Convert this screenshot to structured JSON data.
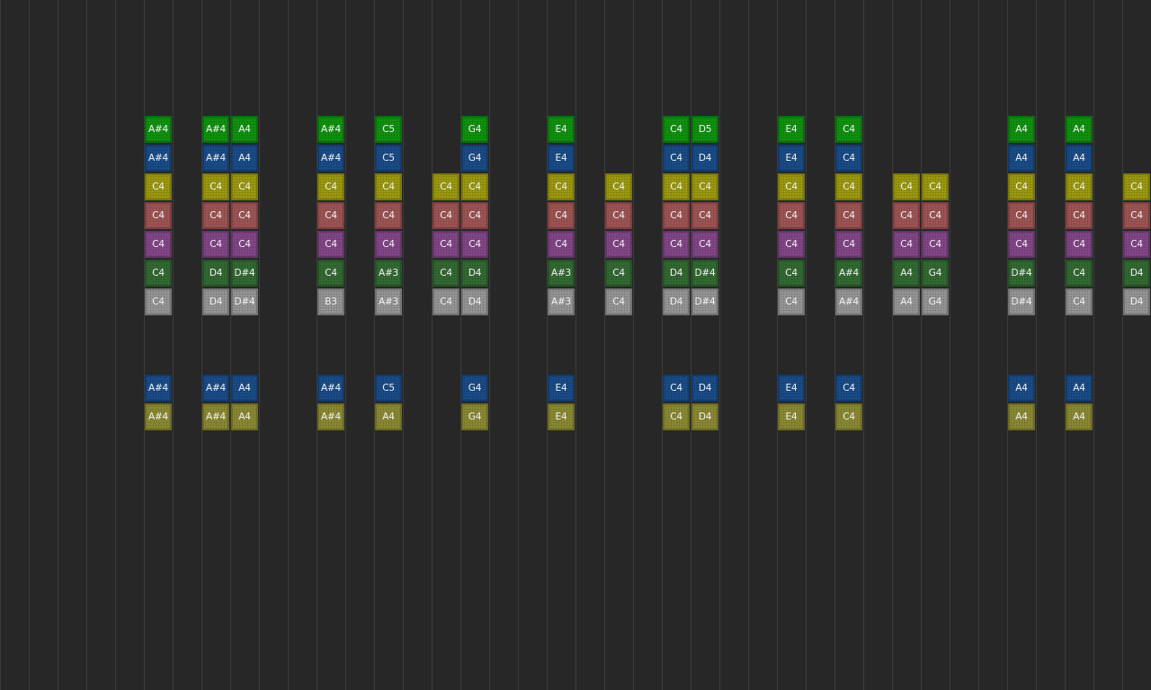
{
  "rows": [
    {
      "name": "green",
      "color": "#119811",
      "border": "#0b6e0b"
    },
    {
      "name": "blue",
      "color": "#1b4f8e",
      "border": "#123a69"
    },
    {
      "name": "yellow",
      "color": "#a3a010",
      "border": "#7b780a"
    },
    {
      "name": "red",
      "color": "#a55858",
      "border": "#7f3f3f"
    },
    {
      "name": "purple",
      "color": "#884a8d",
      "border": "#653569"
    },
    {
      "name": "darkgreen",
      "color": "#356e35",
      "border": "#245224"
    },
    {
      "name": "gray",
      "color": "#9c9c9c",
      "border": "#737373"
    },
    {
      "name": "blue2",
      "color": "#1b4f8e",
      "border": "#123a69"
    },
    {
      "name": "olive",
      "color": "#8f8f36",
      "border": "#6b6b22"
    }
  ],
  "columns": [
    {
      "col": 5,
      "notes": [
        "A#4",
        "A#4",
        "C4",
        "C4",
        "C4",
        "C4",
        "C4",
        "A#4",
        "A#4"
      ]
    },
    {
      "col": 7,
      "notes": [
        "A#4",
        "A#4",
        "C4",
        "C4",
        "C4",
        "D4",
        "D4",
        "A#4",
        "A#4"
      ]
    },
    {
      "col": 8,
      "notes": [
        "A4",
        "A4",
        "C4",
        "C4",
        "C4",
        "D#4",
        "D#4",
        "A4",
        "A4"
      ]
    },
    {
      "col": 11,
      "notes": [
        "A#4",
        "A#4",
        "C4",
        "C4",
        "C4",
        "C4",
        "B3",
        "A#4",
        "A#4"
      ]
    },
    {
      "col": 13,
      "notes": [
        "C5",
        "C5",
        "C4",
        "C4",
        "C4",
        "A#3",
        "A#3",
        "C5",
        "A4"
      ]
    },
    {
      "col": 15,
      "notes": [
        null,
        null,
        "C4",
        "C4",
        "C4",
        "C4",
        "C4",
        null,
        null
      ]
    },
    {
      "col": 16,
      "notes": [
        "G4",
        "G4",
        "C4",
        "C4",
        "C4",
        "D4",
        "D4",
        "G4",
        "G4"
      ]
    },
    {
      "col": 19,
      "notes": [
        "E4",
        "E4",
        "C4",
        "C4",
        "C4",
        "A#3",
        "A#3",
        "E4",
        "E4"
      ]
    },
    {
      "col": 21,
      "notes": [
        null,
        null,
        "C4",
        "C4",
        "C4",
        "C4",
        "C4",
        null,
        null
      ]
    },
    {
      "col": 23,
      "notes": [
        "C4",
        "C4",
        "C4",
        "C4",
        "C4",
        "D4",
        "D4",
        "C4",
        "C4"
      ]
    },
    {
      "col": 24,
      "notes": [
        "D5",
        "D4",
        "C4",
        "C4",
        "C4",
        "D#4",
        "D#4",
        "D4",
        "D4"
      ]
    },
    {
      "col": 27,
      "notes": [
        "E4",
        "E4",
        "C4",
        "C4",
        "C4",
        "C4",
        "C4",
        "E4",
        "E4"
      ]
    },
    {
      "col": 29,
      "notes": [
        "C4",
        "C4",
        "C4",
        "C4",
        "C4",
        "A#4",
        "A#4",
        "C4",
        "C4"
      ]
    },
    {
      "col": 31,
      "notes": [
        null,
        null,
        "C4",
        "C4",
        "C4",
        "A4",
        "A4",
        null,
        null
      ]
    },
    {
      "col": 32,
      "notes": [
        null,
        null,
        "C4",
        "C4",
        "C4",
        "G4",
        "G4",
        null,
        null
      ]
    },
    {
      "col": 35,
      "notes": [
        "A4",
        "A4",
        "C4",
        "C4",
        "C4",
        "D#4",
        "D#4",
        "A4",
        "A4"
      ]
    },
    {
      "col": 37,
      "notes": [
        "A4",
        "A4",
        "C4",
        "C4",
        "C4",
        "C4",
        "C4",
        "A4",
        "A4"
      ]
    },
    {
      "col": 39,
      "notes": [
        null,
        null,
        "C4",
        "C4",
        "C4",
        "D4",
        "D4",
        null,
        null
      ]
    }
  ]
}
